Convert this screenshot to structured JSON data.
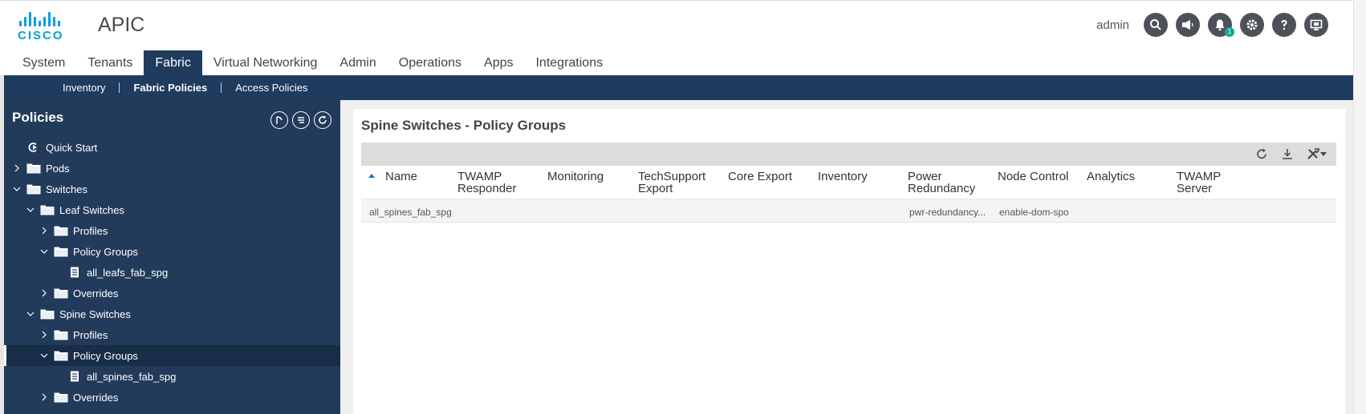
{
  "app": {
    "brand": "CISCO",
    "title": "APIC",
    "user": "admin",
    "notification_count": "1"
  },
  "header_icons": [
    "search-icon",
    "megaphone-icon",
    "bell-icon",
    "gear-icon",
    "help-icon",
    "screen-icon"
  ],
  "main_nav": {
    "tabs": [
      "System",
      "Tenants",
      "Fabric",
      "Virtual Networking",
      "Admin",
      "Operations",
      "Apps",
      "Integrations"
    ],
    "active": "Fabric"
  },
  "sub_nav": {
    "items": [
      "Inventory",
      "Fabric Policies",
      "Access Policies"
    ],
    "active": "Fabric Policies"
  },
  "sidebar": {
    "title": "Policies",
    "tree": [
      {
        "label": "Quick Start",
        "level": 0,
        "icon": "quickstart-icon",
        "chevron": "none"
      },
      {
        "label": "Pods",
        "level": 0,
        "icon": "folder-icon",
        "chevron": "right"
      },
      {
        "label": "Switches",
        "level": 0,
        "icon": "folder-icon",
        "chevron": "down"
      },
      {
        "label": "Leaf Switches",
        "level": 1,
        "icon": "folder-icon",
        "chevron": "down"
      },
      {
        "label": "Profiles",
        "level": 2,
        "icon": "folder-icon",
        "chevron": "right"
      },
      {
        "label": "Policy Groups",
        "level": 2,
        "icon": "folder-icon",
        "chevron": "down"
      },
      {
        "label": "all_leafs_fab_spg",
        "level": 3,
        "icon": "document-icon",
        "chevron": "none"
      },
      {
        "label": "Overrides",
        "level": 2,
        "icon": "folder-icon",
        "chevron": "right"
      },
      {
        "label": "Spine Switches",
        "level": 1,
        "icon": "folder-icon",
        "chevron": "down"
      },
      {
        "label": "Profiles",
        "level": 2,
        "icon": "folder-icon",
        "chevron": "right"
      },
      {
        "label": "Policy Groups",
        "level": 2,
        "icon": "folder-icon",
        "chevron": "down",
        "selected": true
      },
      {
        "label": "all_spines_fab_spg",
        "level": 3,
        "icon": "document-icon",
        "chevron": "none"
      },
      {
        "label": "Overrides",
        "level": 2,
        "icon": "folder-icon",
        "chevron": "right"
      }
    ]
  },
  "content": {
    "title": "Spine Switches - Policy Groups",
    "columns": [
      "Name",
      "TWAMP\nResponder",
      "Monitoring",
      "TechSupport\nExport",
      "Core Export",
      "Inventory",
      "Power\nRedundancy",
      "Node Control",
      "Analytics",
      "TWAMP\nServer"
    ],
    "rows": [
      [
        "all_spines_fab_spg",
        "",
        "",
        "",
        "",
        "",
        "pwr-redundancy...",
        "enable-dom-spo",
        "",
        ""
      ]
    ]
  },
  "colors": {
    "nav_blue": "#1f3b5e",
    "sidebar_blue": "#223b5b",
    "cisco_blue": "#049fd9",
    "badge_green": "#14a792"
  }
}
